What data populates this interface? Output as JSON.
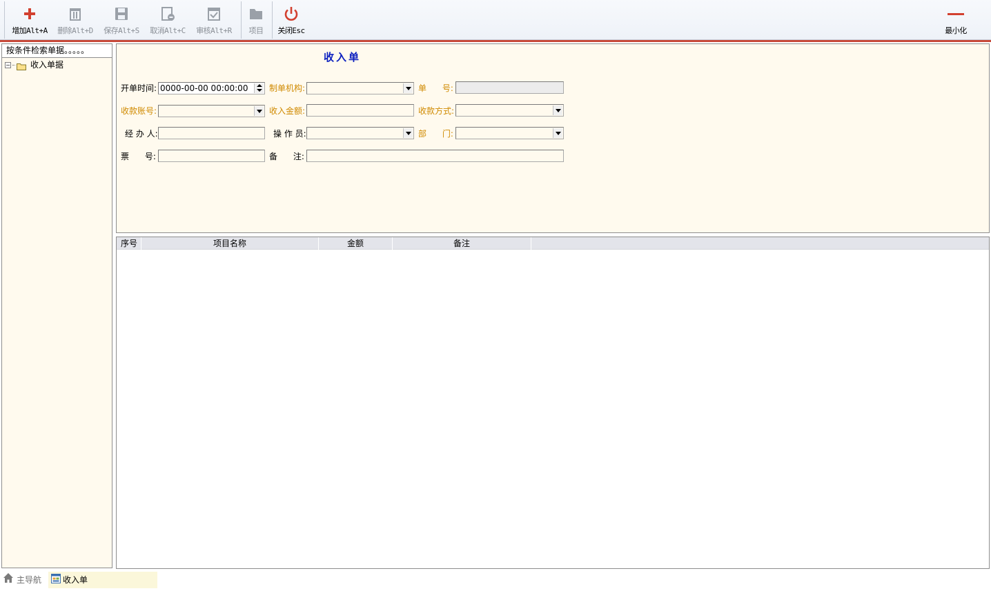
{
  "toolbar": {
    "add": "增加Alt+A",
    "delete": "删除Alt+D",
    "save": "保存Alt+S",
    "cancel": "取消Alt+C",
    "audit": "审核Alt+R",
    "item": "项目",
    "close": "关闭Esc",
    "minimize": "最小化"
  },
  "left_panel": {
    "header": "按条件检索单据。。。。。",
    "tree_root": "收入单据",
    "tree_toggle": "−"
  },
  "form": {
    "title": "收入单",
    "labels": {
      "open_time": "开单时间:",
      "org": "制单机构:",
      "doc_no": "单      号:",
      "account": "收款账号:",
      "amount": "收入金额:",
      "method": "收款方式:",
      "handler": "经 办 人:",
      "operator": "操 作 员:",
      "dept": "部      门:",
      "ticket": "票      号:",
      "remark": "备      注:"
    },
    "values": {
      "open_time": "0000-00-00 00:00:00",
      "org": "",
      "doc_no": "",
      "account": "",
      "amount": "",
      "method": "",
      "handler": "",
      "operator": "",
      "dept": "",
      "ticket": "",
      "remark": ""
    }
  },
  "grid": {
    "columns": [
      "序号",
      "项目名称",
      "金额",
      "备注"
    ],
    "rows": []
  },
  "bottom_tabs": {
    "home": "主导航",
    "active": "收入单"
  },
  "colors": {
    "accent_red": "#c84a3a",
    "title_blue": "#0b1fbf",
    "required_orange": "#d08a00",
    "panel_bg": "#fffaee"
  }
}
